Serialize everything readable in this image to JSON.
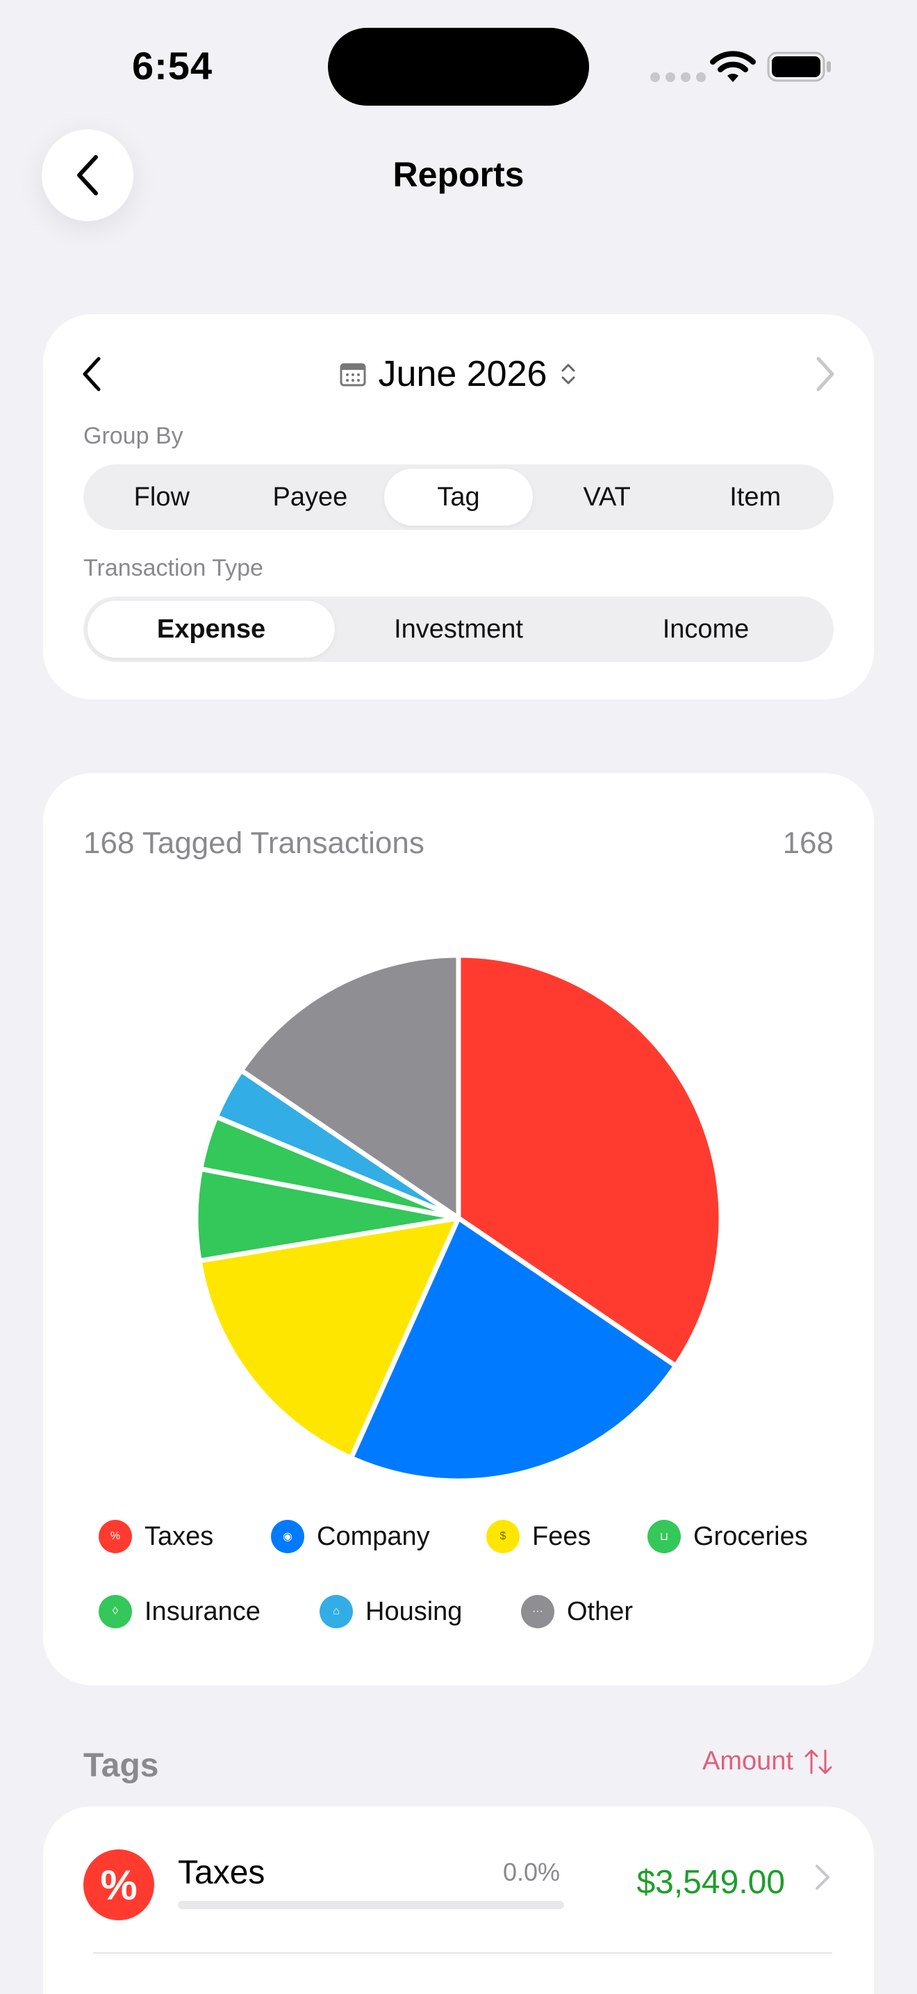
{
  "status": {
    "time": "6:54"
  },
  "nav": {
    "title": "Reports"
  },
  "filters": {
    "month": "June 2026",
    "group_by_label": "Group By",
    "group_by_options": [
      "Flow",
      "Payee",
      "Tag",
      "VAT",
      "Item"
    ],
    "group_by_selected": "Tag",
    "type_label": "Transaction Type",
    "type_options": [
      "Expense",
      "Investment",
      "Income"
    ],
    "type_selected": "Expense"
  },
  "chart_data": {
    "type": "pie",
    "title": "168 Tagged Transactions",
    "count": "168",
    "slices": [
      {
        "label": "Taxes",
        "value": 34.5,
        "color": "#FF3B30"
      },
      {
        "label": "Company",
        "value": 22.2,
        "color": "#007AFF"
      },
      {
        "label": "Fees",
        "value": 15.7,
        "color": "#FFE600"
      },
      {
        "label": "Groceries",
        "value": 5.6,
        "color": "#34C759"
      },
      {
        "label": "Insurance",
        "value": 3.3,
        "color": "#34C759"
      },
      {
        "label": "Housing",
        "value": 3.2,
        "color": "#32ADE6"
      },
      {
        "label": "Other",
        "value": 15.5,
        "color": "#8E8E93"
      }
    ]
  },
  "legend": [
    {
      "label": "Taxes",
      "color": "#FF3B30",
      "icon": "percent-icon"
    },
    {
      "label": "Company",
      "color": "#007AFF",
      "icon": "eye-icon"
    },
    {
      "label": "Fees",
      "color": "#FFE600",
      "icon": "money-bag-icon"
    },
    {
      "label": "Groceries",
      "color": "#34C759",
      "icon": "cart-icon"
    },
    {
      "label": "Insurance",
      "color": "#34C759",
      "icon": "shield-icon"
    },
    {
      "label": "Housing",
      "color": "#32ADE6",
      "icon": "house-icon"
    },
    {
      "label": "Other",
      "color": "#8E8E93",
      "icon": "ellipsis-icon"
    }
  ],
  "tags": {
    "heading": "Tags",
    "sort_label": "Amount",
    "rows": [
      {
        "name": "Taxes",
        "percent": "0.0%",
        "progress": 0.0,
        "amount": "$3,549.00",
        "color": "#FF3B30",
        "icon": "percent-icon"
      }
    ]
  }
}
